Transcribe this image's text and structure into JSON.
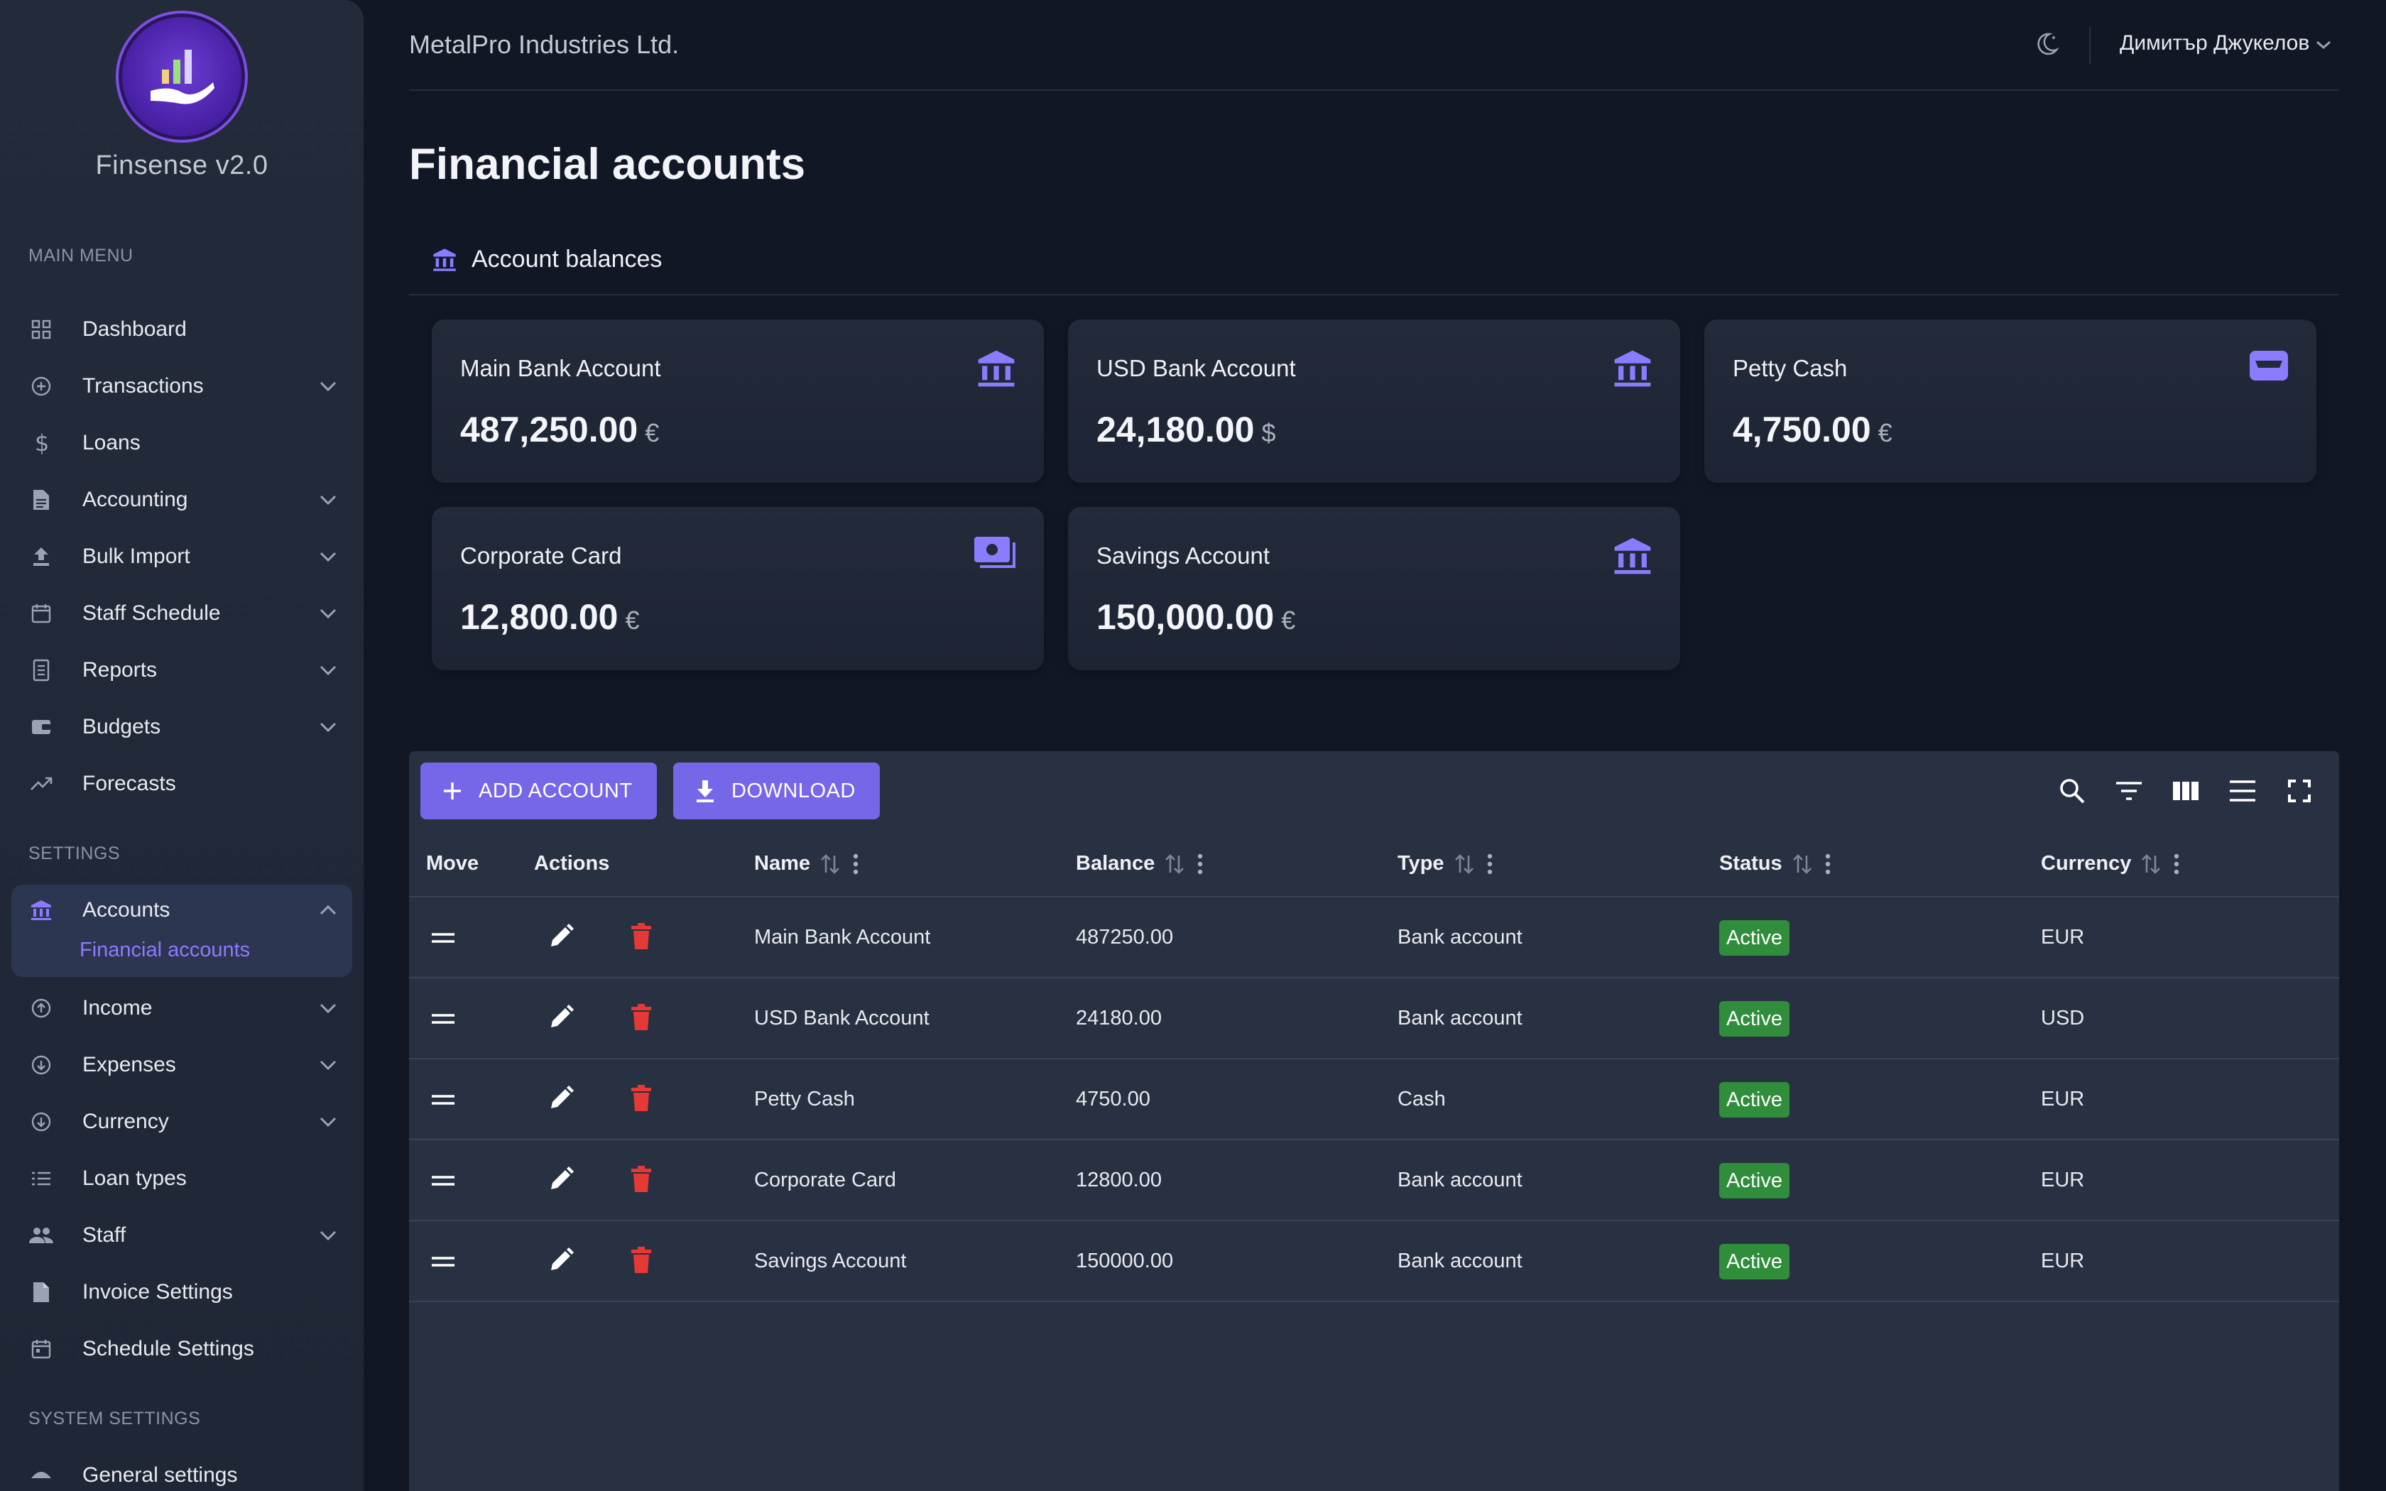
{
  "brand": {
    "name": "Finsense v2.0"
  },
  "sidebar": {
    "main_menu_label": "MAIN MENU",
    "settings_label": "SETTINGS",
    "system_settings_label": "SYSTEM SETTINGS",
    "main_items": [
      {
        "label": "Dashboard",
        "icon": "grid-icon"
      },
      {
        "label": "Transactions",
        "icon": "plus-circle-icon"
      },
      {
        "label": "Loans",
        "icon": "dollar-icon"
      },
      {
        "label": "Accounting",
        "icon": "document-icon"
      },
      {
        "label": "Bulk Import",
        "icon": "upload-icon"
      },
      {
        "label": "Staff Schedule",
        "icon": "calendar-icon"
      },
      {
        "label": "Reports",
        "icon": "report-icon"
      },
      {
        "label": "Budgets",
        "icon": "wallet-icon"
      },
      {
        "label": "Forecasts",
        "icon": "trend-icon"
      }
    ],
    "settings_items": [
      {
        "label": "Accounts",
        "icon": "bank-icon"
      },
      {
        "label": "Income",
        "icon": "arrow-up-circle-icon"
      },
      {
        "label": "Expenses",
        "icon": "arrow-down-circle-icon"
      },
      {
        "label": "Currency",
        "icon": "arrow-down-circle-icon"
      },
      {
        "label": "Loan types",
        "icon": "list-icon"
      },
      {
        "label": "Staff",
        "icon": "people-icon"
      },
      {
        "label": "Invoice Settings",
        "icon": "document-icon"
      },
      {
        "label": "Schedule Settings",
        "icon": "calendar-icon"
      }
    ],
    "active_subitem": "Financial accounts",
    "system_items": [
      {
        "label": "General settings",
        "icon": "umbrella-icon"
      }
    ]
  },
  "header": {
    "company": "MetalPro Industries Ltd.",
    "user": "Димитър Джукелов"
  },
  "page": {
    "title": "Financial accounts",
    "section_title": "Account balances"
  },
  "cards": [
    {
      "name": "Main Bank Account",
      "value": "487,250.00",
      "currency": "€",
      "icon": "bank-icon"
    },
    {
      "name": "USD Bank Account",
      "value": "24,180.00",
      "currency": "$",
      "icon": "bank-icon"
    },
    {
      "name": "Petty Cash",
      "value": "4,750.00",
      "currency": "€",
      "icon": "wallet-icon"
    },
    {
      "name": "Corporate Card",
      "value": "12,800.00",
      "currency": "€",
      "icon": "cash-icon"
    },
    {
      "name": "Savings Account",
      "value": "150,000.00",
      "currency": "€",
      "icon": "bank-icon"
    }
  ],
  "toolbar": {
    "add_label": "ADD ACCOUNT",
    "download_label": "DOWNLOAD"
  },
  "table": {
    "columns": [
      "Move",
      "Actions",
      "Name",
      "Balance",
      "Type",
      "Status",
      "Currency"
    ],
    "rows": [
      {
        "name": "Main Bank Account",
        "balance": "487250.00",
        "type": "Bank account",
        "status": "Active",
        "currency": "EUR"
      },
      {
        "name": "USD Bank Account",
        "balance": "24180.00",
        "type": "Bank account",
        "status": "Active",
        "currency": "USD"
      },
      {
        "name": "Petty Cash",
        "balance": "4750.00",
        "type": "Cash",
        "status": "Active",
        "currency": "EUR"
      },
      {
        "name": "Corporate Card",
        "balance": "12800.00",
        "type": "Bank account",
        "status": "Active",
        "currency": "EUR"
      },
      {
        "name": "Savings Account",
        "balance": "150000.00",
        "type": "Bank account",
        "status": "Active",
        "currency": "EUR"
      }
    ]
  },
  "colors": {
    "accent": "#7667e8",
    "active_badge": "#2f8d3b",
    "delete": "#e53935",
    "sidebar_active_text": "#8b7bff"
  }
}
